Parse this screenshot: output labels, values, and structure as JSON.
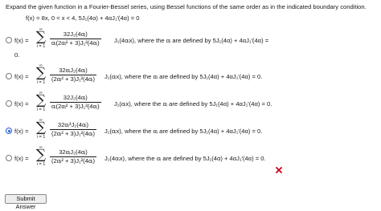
{
  "question": {
    "text": "Expand the given function in a Fourier-Bessel series, using Bessel functions of the same order as in the indicated boundary condition.",
    "condition": "f(x) = 8x,  0 < x < 4,  5J₁(4α) + 4αJ₁′(4α) = 0"
  },
  "choices": [
    {
      "fx": "f(x) =",
      "sum_top": "∞",
      "sum_bottom": "i = 1",
      "numerator": "32J₂(4αᵢ)",
      "denominator": "αᵢ(2αᵢ² + 3)J₁²(4αᵢ)",
      "tail": "J₁(4αᵢx),  where the αᵢ are defined by 5J₁(4α) + 4αJ₁′(4α) =",
      "continuation": "0.",
      "selected": false
    },
    {
      "fx": "f(x) =",
      "sum_top": "∞",
      "sum_bottom": "i = 1",
      "numerator": "32αᵢJ₂(4αᵢ)",
      "denominator": "(2αᵢ² + 3)J₁²(4αᵢ)",
      "tail": "J₁(αᵢx),  where the αᵢ are defined by 5J₁(4α) + 4αJ₁′(4α) = 0.",
      "continuation": "",
      "selected": false
    },
    {
      "fx": "f(x) =",
      "sum_top": "∞",
      "sum_bottom": "i = 1",
      "numerator": "32J₂(4αᵢ)",
      "denominator": "αᵢ(2αᵢ² + 3)J₁²(4αᵢ)",
      "tail": "J₁(αᵢx),  where the αᵢ are defined by 5J₁(4α) + 4αJ₁′(4α) = 0.",
      "continuation": "",
      "selected": false
    },
    {
      "fx": "f(x) =",
      "sum_top": "∞",
      "sum_bottom": "i = 1",
      "numerator": "32αᵢ³J₂(4αᵢ)",
      "denominator": "(2αᵢ² + 3)J₁²(4αᵢ)",
      "tail": "J₁(αᵢx),  where the αᵢ are defined by 5J₁(4α) + 4αJ₁′(4α) = 0.",
      "continuation": "",
      "selected": true
    },
    {
      "fx": "f(x) =",
      "sum_top": "∞",
      "sum_bottom": "i = 1",
      "numerator": "32αᵢJ₂(4αᵢ)",
      "denominator": "(2αᵢ² + 3)J₁²(4αᵢ)",
      "tail": "J₁(4αᵢx),  where the αᵢ are defined by 5J₁(4α) + 4αJ₁′(4α) = 0.",
      "continuation": "",
      "selected": false
    }
  ],
  "feedback": {
    "icon": "wrong-x-icon",
    "color": "#d0021b"
  },
  "submit_label": "Submit Answer"
}
